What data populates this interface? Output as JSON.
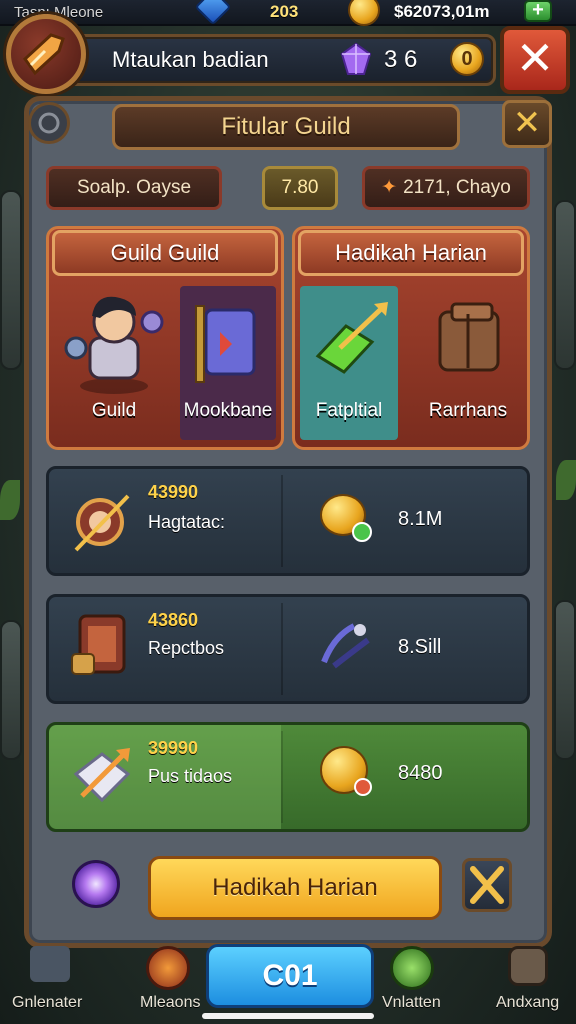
{
  "topbar": {
    "left_text": "Tasnı Mleone",
    "gems_value": "203",
    "gold_value": "$62073,01m",
    "plus": "+"
  },
  "header": {
    "player_name": "Mtaukan badian",
    "gem_count": "3 6",
    "badge": "0",
    "close_glyph": "✕"
  },
  "panel": {
    "title": "Fitular Guild",
    "close_glyph": "✕",
    "stats": {
      "left": "Soalp. Oayse",
      "center": "7.80",
      "right": "2171, Chayo"
    }
  },
  "cards": [
    {
      "header": "Guild Guild",
      "tiles": [
        {
          "label": "Guild",
          "icon": "hero-icon"
        },
        {
          "label": "Mookbane",
          "icon": "book-icon"
        }
      ]
    },
    {
      "header": "Hadikah Harian",
      "tiles": [
        {
          "label": "Fatpltial",
          "icon": "arrow-gem-icon"
        },
        {
          "label": "Rarrhans",
          "icon": "chest-icon"
        }
      ]
    }
  ],
  "rewards": [
    {
      "number": "43990",
      "name": "Hagtatac:",
      "value": "8.1M",
      "icon": "bow-icon",
      "reward_icon": "gold-coin-icon"
    },
    {
      "number": "43860",
      "name": "Repctbos",
      "value": "8.Sill",
      "icon": "treasure-chest-icon",
      "reward_icon": "claw-icon"
    },
    {
      "number": "39990",
      "name": "Pus tidaos",
      "value": "8480",
      "icon": "arrow-shield-icon",
      "reward_icon": "gold-coin-icon"
    }
  ],
  "actions": {
    "claim_label": "Hadikah Harian",
    "confirm_label": "C01"
  },
  "nav": {
    "items": [
      "Gnlenater",
      "Mleaons",
      "Vnlatten",
      "Andxang"
    ]
  },
  "colors": {
    "accent": "#f0a51e",
    "panel": "#58606a",
    "frame": "#6a4a2c",
    "card_red": "#a8452f"
  }
}
